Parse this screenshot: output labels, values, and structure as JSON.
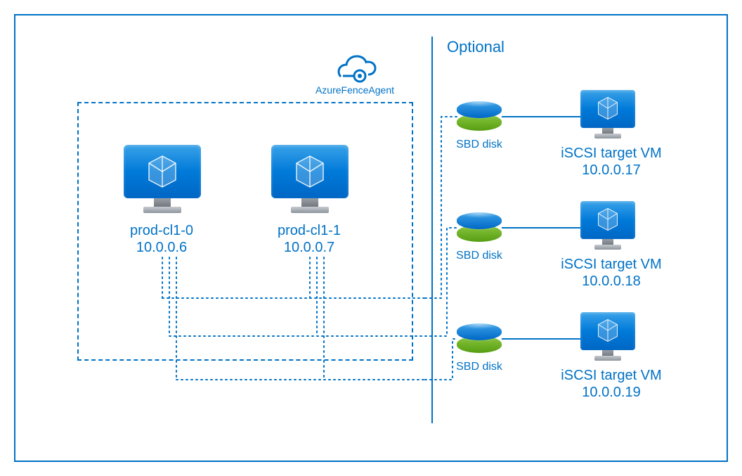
{
  "fenceAgent": {
    "label": "AzureFenceAgent"
  },
  "optionalHeading": "Optional",
  "clusterNodes": [
    {
      "name": "prod-cl1-0",
      "ip": "10.0.0.6"
    },
    {
      "name": "prod-cl1-1",
      "ip": "10.0.0.7"
    }
  ],
  "sbdDiskLabel": "SBD disk",
  "iscsiTargets": [
    {
      "label": "iSCSI target VM",
      "ip": "10.0.0.17"
    },
    {
      "label": "iSCSI target VM",
      "ip": "10.0.0.18"
    },
    {
      "label": "iSCSI target VM",
      "ip": "10.0.0.19"
    }
  ],
  "colors": {
    "azureBlue": "#0072C6",
    "green": "#559E12"
  }
}
